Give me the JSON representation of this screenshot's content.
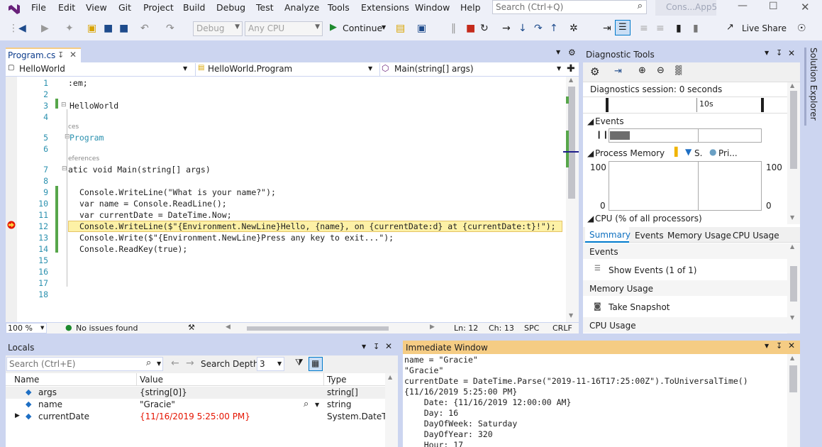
{
  "menu": {
    "items": [
      "File",
      "Edit",
      "View",
      "Git",
      "Project",
      "Build",
      "Debug",
      "Test",
      "Analyze",
      "Tools",
      "Extensions",
      "Window",
      "Help"
    ],
    "search_placeholder": "Search (Ctrl+Q)",
    "solution_name": "Cons...App5"
  },
  "toolbar": {
    "config": "Debug",
    "platform": "Any CPU",
    "continue_label": "Continue",
    "live_share": "Live Share"
  },
  "editor": {
    "tab_label": "Program.cs",
    "nav_project": "HelloWorld",
    "nav_class": "HelloWorld.Program",
    "nav_member": "Main(string[] args)",
    "lines": [
      {
        "n": "1",
        "code": ":em;"
      },
      {
        "n": "2",
        "code": ""
      },
      {
        "n": "3",
        "code": "HelloWorld"
      },
      {
        "n": "4",
        "code": ""
      },
      {
        "n": "5",
        "code": "Program"
      },
      {
        "n": "6",
        "code": ""
      },
      {
        "n": "7",
        "code": "atic void Main(string[] args)"
      },
      {
        "n": "8",
        "code": ""
      },
      {
        "n": "9",
        "code": "Console.WriteLine(\"What is your name?\");"
      },
      {
        "n": "10",
        "code": "var name = Console.ReadLine();"
      },
      {
        "n": "11",
        "code": "var currentDate = DateTime.Now;"
      },
      {
        "n": "12",
        "code": "Console.WriteLine($\"{Environment.NewLine}Hello, {name}, on {currentDate:d} at {currentDate:t}!\");"
      },
      {
        "n": "13",
        "code": "Console.Write($\"{Environment.NewLine}Press any key to exit...\");"
      },
      {
        "n": "14",
        "code": "Console.ReadKey(true);"
      },
      {
        "n": "15",
        "code": ""
      },
      {
        "n": "16",
        "code": ""
      },
      {
        "n": "17",
        "code": ""
      },
      {
        "n": "18",
        "code": ""
      }
    ],
    "codelens_1": "ces",
    "codelens_2": "eferences",
    "zoom": "100 %",
    "status_issues": "No issues found",
    "ln": "Ln: 12",
    "ch": "Ch: 13",
    "spc": "SPC",
    "crlf": "CRLF"
  },
  "diagnostics": {
    "title": "Diagnostic Tools",
    "session": "Diagnostics session: 0 seconds",
    "timeline_label": "10s",
    "events_label": "Events",
    "process_memory": "Process Memory",
    "legend_s": "S.",
    "legend_pri": "Pri...",
    "mem_top_left": "100",
    "mem_top_right": "100",
    "mem_bottom_left": "0",
    "mem_bottom_right": "0",
    "cpu_label": "CPU (% of all processors)",
    "tabs": [
      "Summary",
      "Events",
      "Memory Usage",
      "CPU Usage"
    ],
    "sec_events": "Events",
    "show_events": "Show Events (1 of 1)",
    "sec_memory": "Memory Usage",
    "take_snapshot": "Take Snapshot",
    "sec_cpu": "CPU Usage"
  },
  "solution_explorer_label": "Solution Explorer",
  "locals": {
    "title": "Locals",
    "search_placeholder": "Search (Ctrl+E)",
    "search_depth_label": "Search Depth:",
    "search_depth_value": "3",
    "headers": [
      "Name",
      "Value",
      "Type"
    ],
    "rows": [
      {
        "name": "args",
        "value": "{string[0]}",
        "type": "string[]"
      },
      {
        "name": "name",
        "value": "\"Gracie\"",
        "type": "string"
      },
      {
        "name": "currentDate",
        "value": "{11/16/2019 5:25:00 PM}",
        "type": "System.DateTi..."
      }
    ],
    "changed_color": "#e51400"
  },
  "immediate": {
    "title": "Immediate Window",
    "lines": [
      "name = \"Gracie\"",
      "\"Gracie\"",
      "currentDate = DateTime.Parse(\"2019-11-16T17:25:00Z\").ToUniversalTime()",
      "{11/16/2019 5:25:00 PM}",
      "    Date: {11/16/2019 12:00:00 AM}",
      "    Day: 16",
      "    DayOfWeek: Saturday",
      "    DayOfYear: 320",
      "    Hour: 17"
    ]
  },
  "colors": {
    "accent": "#007acc",
    "highlight_line": "#fdf1a6",
    "breakpoint_arrow": "#e51400",
    "active_tab": "#f5cc84"
  }
}
